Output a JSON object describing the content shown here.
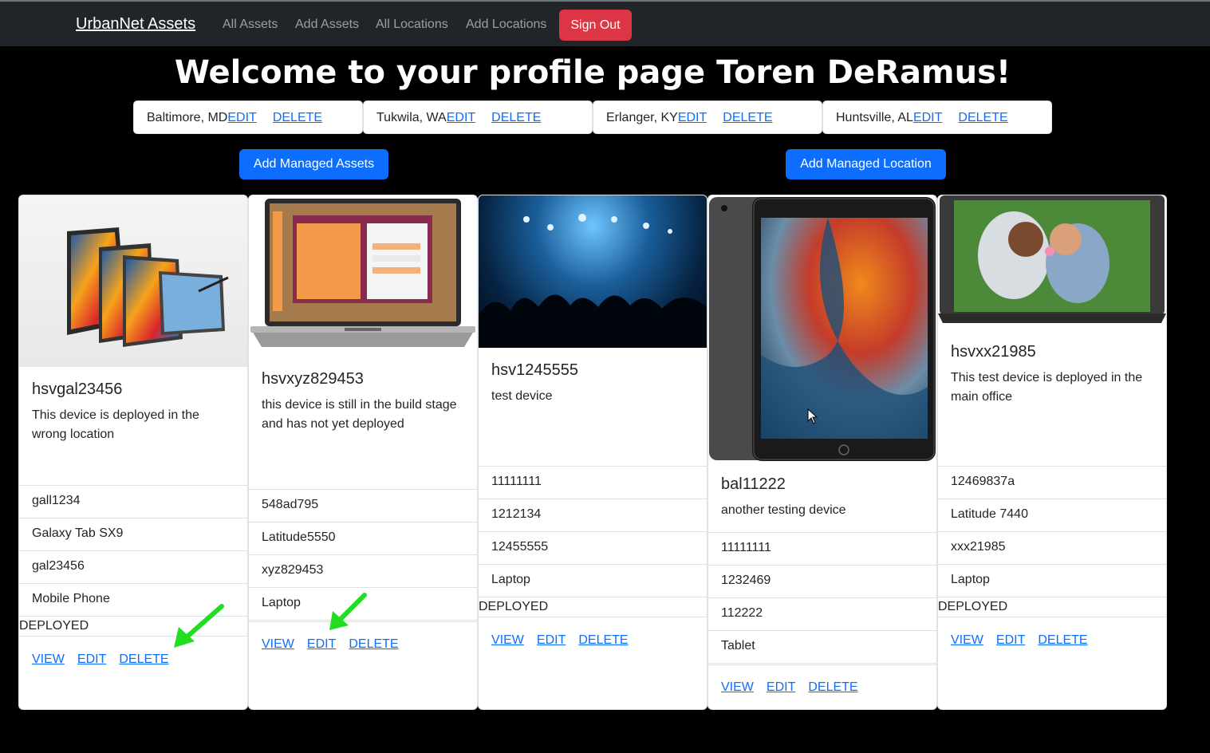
{
  "nav": {
    "brand": "UrbanNet Assets",
    "links": [
      "All Assets",
      "Add Assets",
      "All Locations",
      "Add Locations"
    ],
    "signout": "Sign Out"
  },
  "welcome": "Welcome to your profile page Toren DeRamus!",
  "locations": [
    {
      "name": "Baltimore, MD",
      "edit": "EDIT",
      "delete": "DELETE"
    },
    {
      "name": "Tukwila, WA",
      "edit": "EDIT",
      "delete": "DELETE"
    },
    {
      "name": "Erlanger, KY",
      "edit": "EDIT",
      "delete": "DELETE"
    },
    {
      "name": "Huntsville, AL",
      "edit": "EDIT",
      "delete": "DELETE"
    }
  ],
  "buttons": {
    "add_assets": "Add Managed Assets",
    "add_location": "Add Managed Location"
  },
  "cards": [
    {
      "title": "hsvgal23456",
      "text": "This device is deployed in the wrong location",
      "items": [
        "gall1234",
        "Galaxy Tab SX9",
        "gal23456",
        "Mobile Phone"
      ],
      "status": "DEPLOYED",
      "view": "VIEW",
      "edit": "EDIT",
      "delete": "DELETE"
    },
    {
      "title": "hsvxyz829453",
      "text": "this device is still in the build stage and has not yet deployed",
      "items": [
        "548ad795",
        "Latitude5550",
        "xyz829453",
        "Laptop"
      ],
      "status": "",
      "view": "VIEW",
      "edit": "EDIT",
      "delete": "DELETE"
    },
    {
      "title": "hsv1245555",
      "text": "test device",
      "items": [
        "11111111",
        "1212134",
        "12455555",
        "Laptop"
      ],
      "status": "DEPLOYED",
      "view": "VIEW",
      "edit": "EDIT",
      "delete": "DELETE"
    },
    {
      "title": "bal11222",
      "text": "another testing device",
      "items": [
        "11111111",
        "1232469",
        "112222",
        "Tablet"
      ],
      "status": "",
      "view": "VIEW",
      "edit": "EDIT",
      "delete": "DELETE"
    },
    {
      "title": "hsvxx21985",
      "text": "This test device is deployed in the main office",
      "items": [
        "12469837a",
        "Latitude 7440",
        "xxx21985",
        "Laptop"
      ],
      "status": "DEPLOYED",
      "view": "VIEW",
      "edit": "EDIT",
      "delete": "DELETE"
    }
  ],
  "colors": {
    "navbar": "#212529",
    "primary": "#0d6efd",
    "danger": "#dc3545",
    "annotation_arrow": "#22dd22"
  }
}
